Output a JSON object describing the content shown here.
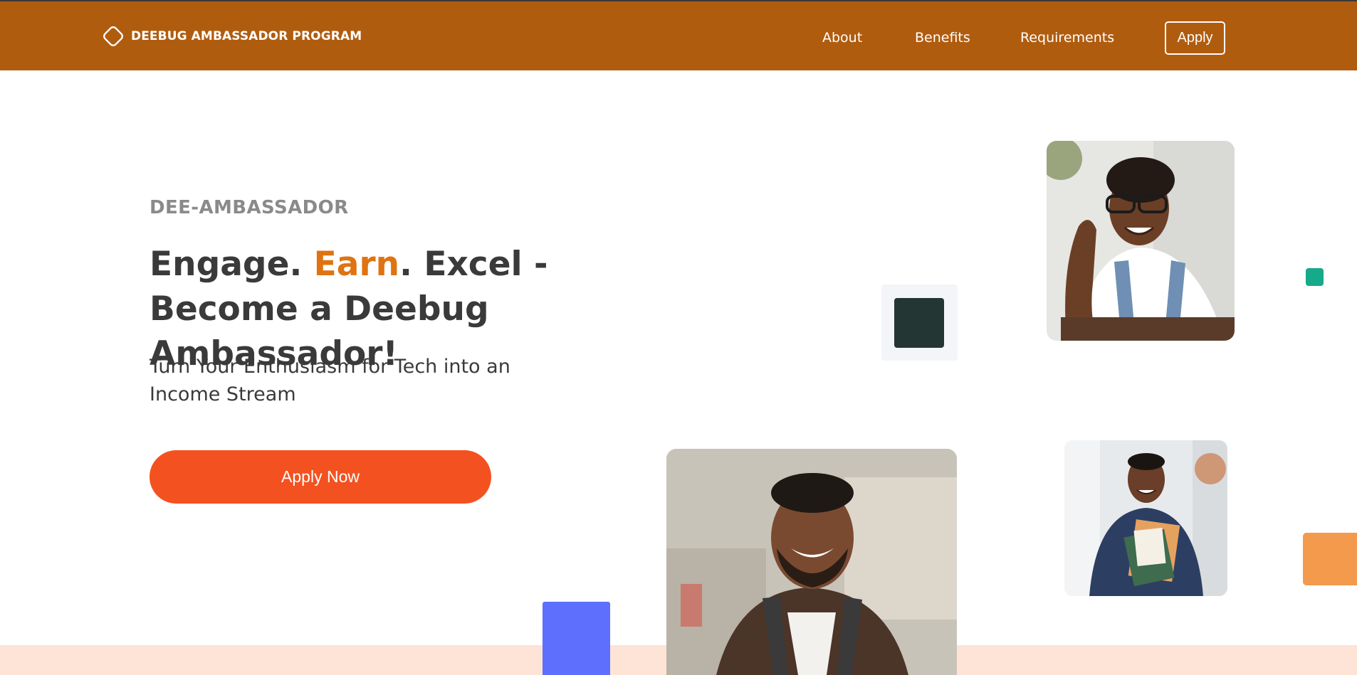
{
  "nav": {
    "brand": "DEEBUG AMBASSADOR PROGRAM",
    "links": [
      "About",
      "Benefits",
      "Requirements"
    ],
    "apply_label": "Apply"
  },
  "hero": {
    "eyebrow": "DEE-AMBASSADOR",
    "headline_part1": "Engage. ",
    "headline_accent": "Earn",
    "headline_part2": ". Excel - Become a Deebug Ambassador!",
    "subheadline": "Turn Your Enthusiasm for Tech into an Income Stream",
    "cta_label": "Apply Now"
  },
  "colors": {
    "nav_bg": "#b05c0f",
    "accent_text": "#df7312",
    "cta_bg": "#f45120",
    "teal": "#16a98a",
    "orange_block": "#f39a4c",
    "blue_block": "#5e6ffd",
    "band": "#fde4d6"
  },
  "icons": {
    "brand_logo": "rotated-square-logo-icon"
  }
}
